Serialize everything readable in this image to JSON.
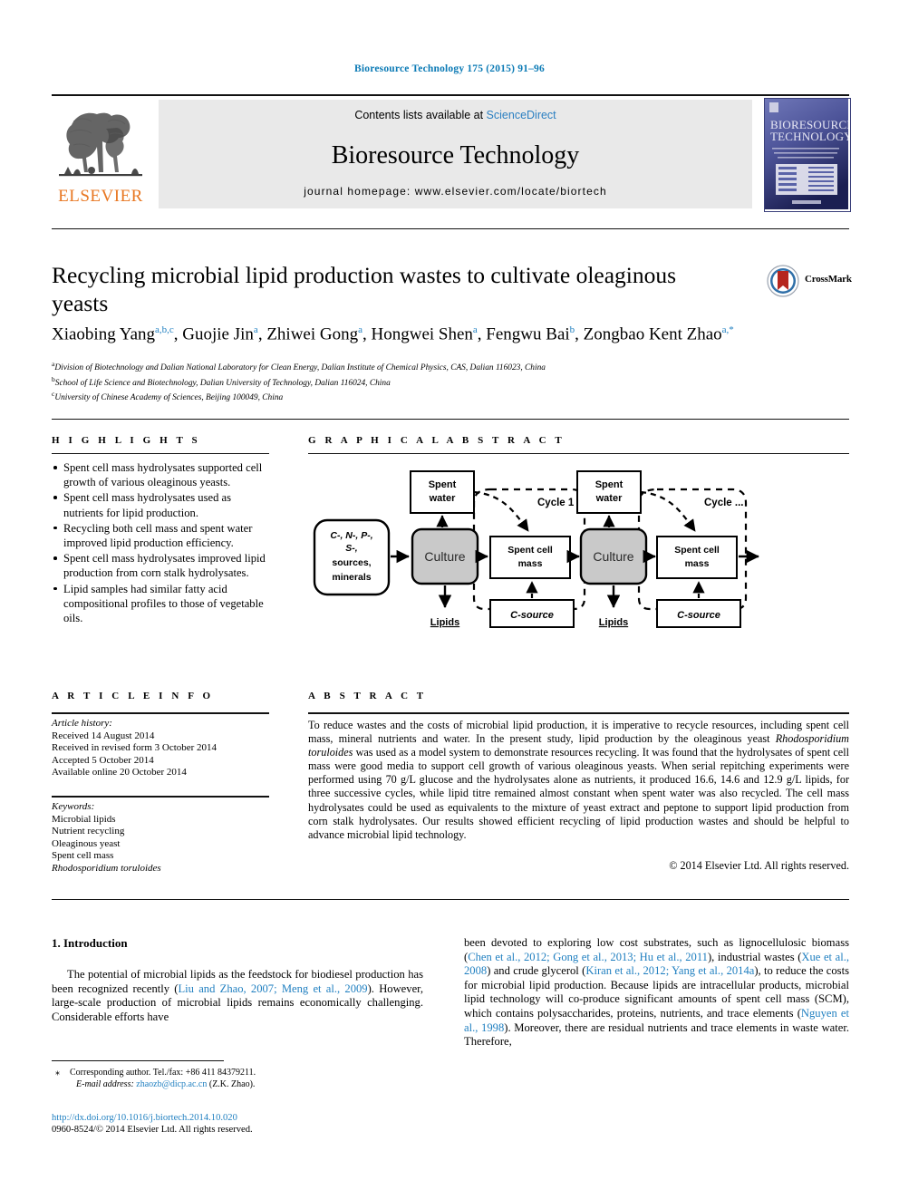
{
  "running_head": "Bioresource Technology 175 (2015) 91–96",
  "masthead": {
    "contents_prefix": "Contents lists available at ",
    "sciencedirect": "ScienceDirect",
    "journal_title": "Bioresource Technology",
    "homepage": "journal homepage: www.elsevier.com/locate/biortech",
    "publisher": "ELSEVIER",
    "cover_title_line1": "BIORESOURCE",
    "cover_title_line2": "TECHNOLOGY",
    "publisher_color": "#e87722",
    "link_color": "#2a7fc1"
  },
  "article": {
    "title": "Recycling microbial lipid production wastes to cultivate oleaginous yeasts",
    "crossmark_label": "CrossMark",
    "authors": [
      {
        "name": "Xiaobing Yang",
        "sup": "a,b,c",
        "sep": ", "
      },
      {
        "name": "Guojie Jin",
        "sup": "a",
        "sep": ", "
      },
      {
        "name": "Zhiwei Gong",
        "sup": "a",
        "sep": ", "
      },
      {
        "name": "Hongwei Shen",
        "sup": "a",
        "sep": ", "
      },
      {
        "name": "Fengwu Bai",
        "sup": "b",
        "sep": ", "
      },
      {
        "name": "Zongbao Kent Zhao",
        "sup": "a,*",
        "sep": ""
      }
    ],
    "affiliations": [
      {
        "sup": "a",
        "text": "Division of Biotechnology and Dalian National Laboratory for Clean Energy, Dalian Institute of Chemical Physics, CAS, Dalian 116023, China"
      },
      {
        "sup": "b",
        "text": "School of Life Science and Biotechnology, Dalian University of Technology, Dalian 116024, China"
      },
      {
        "sup": "c",
        "text": "University of Chinese Academy of Sciences, Beijing 100049, China"
      }
    ]
  },
  "highlights": {
    "heading": "H I G H L I G H T S",
    "items": [
      "Spent cell mass hydrolysates supported cell growth of various oleaginous yeasts.",
      "Spent cell mass hydrolysates used as nutrients for lipid production.",
      "Recycling both cell mass and spent water improved lipid production efficiency.",
      "Spent cell mass hydrolysates improved lipid production from corn stalk hydrolysates.",
      "Lipid samples had similar fatty acid compositional profiles to those of vegetable oils."
    ]
  },
  "graphical_abstract": {
    "heading": "G R A P H I C A L   A B S T R A C T",
    "nodes": {
      "feedstock": "C-, N-, P-, S-, sources, minerals",
      "feedstock_lines": [
        "C-, N-, P-,",
        "S-,",
        "sources,",
        "minerals"
      ],
      "culture": "Culture",
      "spent_water": [
        "Spent",
        "water"
      ],
      "spent_cell_mass": [
        "Spent  cell",
        "mass"
      ],
      "lipids": "Lipids",
      "c_source": "C-source",
      "cycle1": "Cycle 1",
      "cycle_n": "Cycle ..."
    },
    "culture_fill": "#c9c9c9"
  },
  "article_info": {
    "heading": "A R T I C L E   I N F O",
    "history_label": "Article history:",
    "history": [
      "Received 14 August 2014",
      "Received in revised form 3 October 2014",
      "Accepted 5 October 2014",
      "Available online 20 October 2014"
    ],
    "keywords_label": "Keywords:",
    "keywords": [
      "Microbial lipids",
      "Nutrient recycling",
      "Oleaginous yeast",
      "Spent cell mass"
    ],
    "keyword_italic": "Rhodosporidium toruloides"
  },
  "abstract": {
    "heading": "A B S T R A C T",
    "part1": "To reduce wastes and the costs of microbial lipid production, it is imperative to recycle resources, including spent cell mass, mineral nutrients and water. In the present study, lipid production by the oleaginous yeast ",
    "species": "Rhodosporidium toruloides",
    "part2": " was used as a model system to demonstrate resources recycling. It was found that the hydrolysates of spent cell mass were good media to support cell growth of various oleaginous yeasts. When serial repitching experiments were performed using 70 g/L glucose and the hydrolysates alone as nutrients, it produced 16.6, 14.6 and 12.9 g/L lipids, for three successive cycles, while lipid titre remained almost constant when spent water was also recycled. The cell mass hydrolysates could be used as equivalents to the mixture of yeast extract and peptone to support lipid production from corn stalk hydrolysates. Our results showed efficient recycling of lipid production wastes and should be helpful to advance microbial lipid technology.",
    "copyright": "© 2014 Elsevier Ltd. All rights reserved."
  },
  "body": {
    "section_number_title": "1. Introduction",
    "left_paragraph": {
      "t1": "The potential of microbial lipids as the feedstock for biodiesel production has been recognized recently (",
      "ref1": "Liu and Zhao, 2007; Meng et al., 2009",
      "t2": "). However, large-scale production of microbial lipids remains economically challenging. Considerable efforts have"
    },
    "right_paragraph": {
      "t1": "been devoted to exploring low cost substrates, such as lignocellulosic biomass (",
      "ref1": "Chen et al., 2012; Gong et al., 2013; Hu et al., 2011",
      "t2": "), industrial wastes (",
      "ref2": "Xue et al., 2008",
      "t3": ") and crude glycerol (",
      "ref3": "Kiran et al., 2012; Yang et al., 2014a",
      "t4": "), to reduce the costs for microbial lipid production. Because lipids are intracellular products, microbial lipid technology will co-produce significant amounts of spent cell mass (SCM), which contains polysaccharides, proteins, nutrients, and trace elements (",
      "ref4": "Nguyen et al., 1998",
      "t5": "). Moreover, there are residual nutrients and trace elements in waste water. Therefore,"
    }
  },
  "footer": {
    "corresponding_star": "⁎",
    "corresponding": "Corresponding author. Tel./fax: +86 411 84379211.",
    "email_label": "E-mail address:",
    "email": "zhaozb@dicp.ac.cn",
    "email_owner": " (Z.K. Zhao).",
    "doi": "http://dx.doi.org/10.1016/j.biortech.2014.10.020",
    "issn_line": "0960-8524/© 2014 Elsevier Ltd. All rights reserved."
  }
}
